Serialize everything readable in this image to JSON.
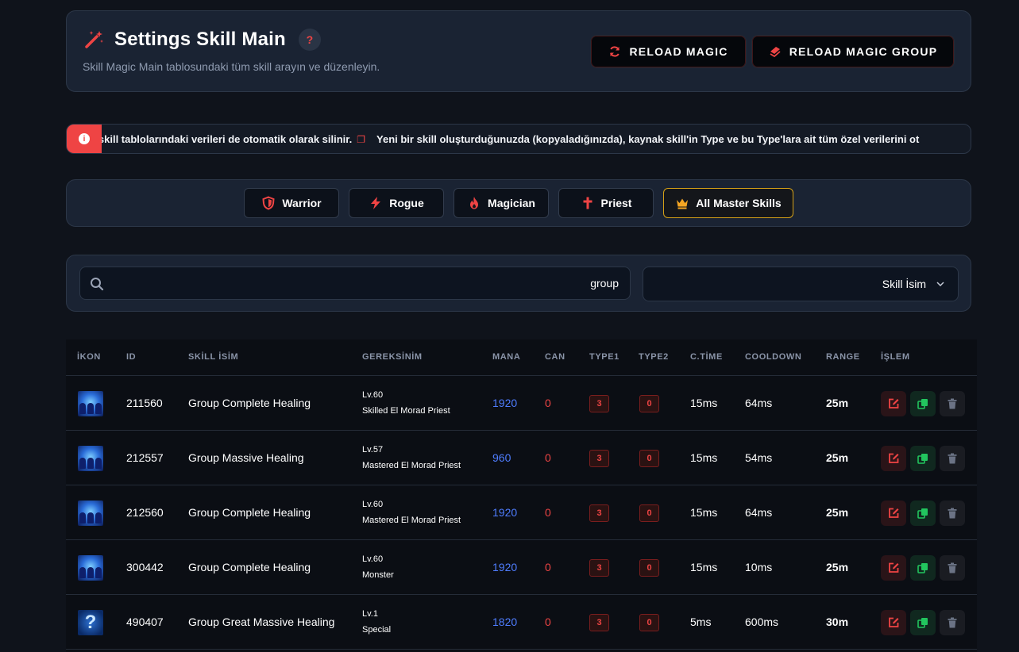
{
  "header": {
    "title": "Settings Skill Main",
    "help_label": "?",
    "subtitle": "Skill Magic Main tablosundaki tüm skill arayın ve düzenleyin.",
    "reload_magic_label": "RELOAD MAGIC",
    "reload_magic_group_label": "RELOAD MAGIC GROUP"
  },
  "notice": {
    "text_a": "er skill tablolarındaki verileri de otomatik olarak silinir.",
    "text_b": "Yeni bir skill oluşturduğunuzda (kopyaladığınızda), kaynak skill'in Type ve bu Type'lara ait tüm özel verilerini ot"
  },
  "classes": [
    {
      "label": "Warrior",
      "icon": "shield-icon",
      "color": "#ef4444"
    },
    {
      "label": "Rogue",
      "icon": "lightning-icon",
      "color": "#ef4444"
    },
    {
      "label": "Magician",
      "icon": "fire-icon",
      "color": "#ef4444"
    },
    {
      "label": "Priest",
      "icon": "cross-icon",
      "color": "#ef4444"
    },
    {
      "label": "All Master Skills",
      "icon": "crown-icon",
      "color": "#f5a623"
    }
  ],
  "search": {
    "value": "group",
    "placeholder": "",
    "filter_selected": "Skill İsim"
  },
  "table": {
    "columns": [
      "İKON",
      "ID",
      "SKİLL İSİM",
      "GEREKSİNİM",
      "MANA",
      "CAN",
      "TYPE1",
      "TYPE2",
      "C.TİME",
      "COOLDOWN",
      "RANGE",
      "İŞLEM"
    ],
    "rows": [
      {
        "icon": "group-healing-icon",
        "id": "211560",
        "name": "Group Complete Healing",
        "level": "Lv.60",
        "req_class": "Skilled El Morad Priest",
        "mana": "1920",
        "can": "0",
        "type1": "3",
        "type2": "0",
        "ctime": "15ms",
        "cooldown": "64ms",
        "range": "25m"
      },
      {
        "icon": "group-healing-icon",
        "id": "212557",
        "name": "Group Massive Healing",
        "level": "Lv.57",
        "req_class": "Mastered El Morad Priest",
        "mana": "960",
        "can": "0",
        "type1": "3",
        "type2": "0",
        "ctime": "15ms",
        "cooldown": "54ms",
        "range": "25m"
      },
      {
        "icon": "group-healing-icon",
        "id": "212560",
        "name": "Group Complete Healing",
        "level": "Lv.60",
        "req_class": "Mastered El Morad Priest",
        "mana": "1920",
        "can": "0",
        "type1": "3",
        "type2": "0",
        "ctime": "15ms",
        "cooldown": "64ms",
        "range": "25m"
      },
      {
        "icon": "group-healing-icon",
        "id": "300442",
        "name": "Group Complete Healing",
        "level": "Lv.60",
        "req_class": "Monster",
        "mana": "1920",
        "can": "0",
        "type1": "3",
        "type2": "0",
        "ctime": "15ms",
        "cooldown": "10ms",
        "range": "25m"
      },
      {
        "icon": "question-icon",
        "id": "490407",
        "name": "Group Great Massive Healing",
        "level": "Lv.1",
        "req_class": "Special",
        "mana": "1820",
        "can": "0",
        "type1": "3",
        "type2": "0",
        "ctime": "5ms",
        "cooldown": "600ms",
        "range": "30m"
      }
    ]
  }
}
